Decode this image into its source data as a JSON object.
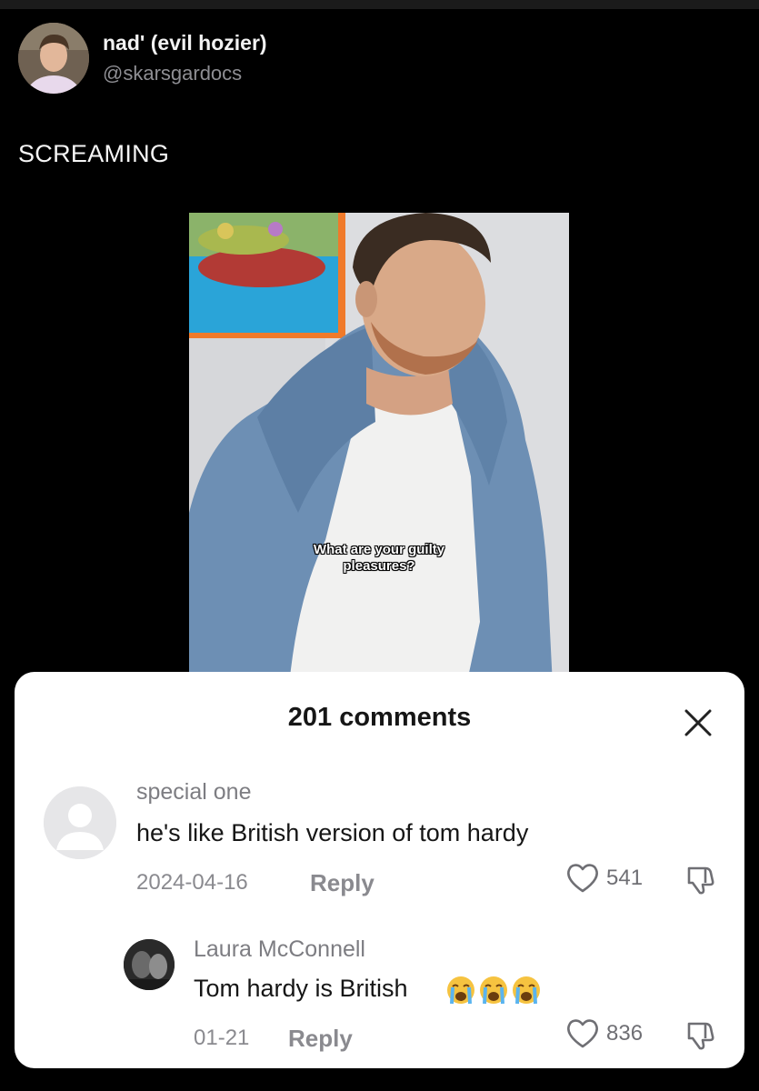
{
  "tweet": {
    "display_name": "nad' (evil hozier)",
    "handle": "@skarsgardocs",
    "text": "SCREAMING"
  },
  "media": {
    "caption_line1": "What are your guilty",
    "caption_line2": "pleasures?"
  },
  "comments_sheet": {
    "title": "201 comments",
    "close_icon": "close-icon",
    "comments": [
      {
        "username": "special one",
        "text": "he's like British version of tom hardy",
        "date": "2024-04-16",
        "reply_label": "Reply",
        "likes": "541"
      },
      {
        "username": "Laura McConnell",
        "text": "Tom hardy is British",
        "emoji": "😭😭😭",
        "date": "01-21",
        "reply_label": "Reply",
        "likes": "836"
      }
    ]
  },
  "colors": {
    "background": "#000000",
    "sheet": "#ffffff",
    "muted_text": "#8a8a8f",
    "primary_text": "#161616"
  }
}
